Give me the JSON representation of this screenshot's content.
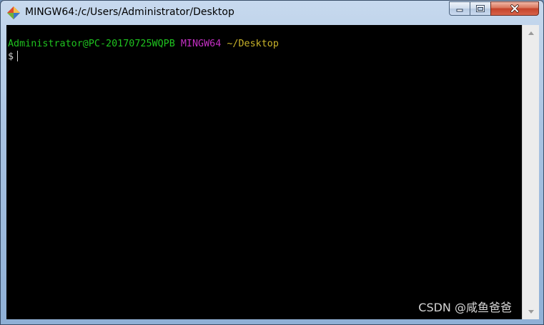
{
  "window": {
    "title": "MINGW64:/c/Users/Administrator/Desktop",
    "app_icon": "git-bash-diamond-icon",
    "controls": {
      "minimize_icon": "minimize-icon",
      "maximize_icon": "maximize-icon",
      "close_icon": "close-icon"
    }
  },
  "terminal": {
    "prompt_user": "Administrator@PC-20170725WQPB",
    "prompt_system": "MINGW64",
    "prompt_path": "~/Desktop",
    "prompt_symbol": "$",
    "colors": {
      "background": "#000000",
      "user": "#1fc31f",
      "system": "#c42fc4",
      "path": "#c9b32a"
    }
  },
  "watermark": {
    "text": "CSDN @咸鱼爸爸"
  }
}
